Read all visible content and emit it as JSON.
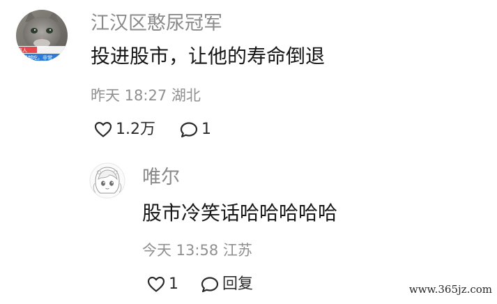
{
  "main_comment": {
    "avatar_caption_top": "事人",
    "avatar_caption_bottom": "就是越吃，非常",
    "username": "江汉区憨尿冠军",
    "text": "投进股市，让他的寿命倒退",
    "meta": "昨天 18:27 湖北",
    "like_count": "1.2万",
    "reply_count": "1",
    "like_icon": "heart-icon",
    "reply_icon": "speech-bubble-icon"
  },
  "reply_comment": {
    "username": "唯尔",
    "text": "股市冷笑话哈哈哈哈哈",
    "meta": "今天 13:58 江苏",
    "like_count": "1",
    "reply_label": "回复",
    "like_icon": "heart-icon",
    "reply_icon": "speech-bubble-icon"
  },
  "watermark": "www.365jz.com",
  "colors": {
    "username": "#8a8a8a",
    "text": "#151515",
    "meta": "#8f8f8f",
    "action": "#2a2a2a",
    "avatar_caption_bg": "#e5484d"
  }
}
